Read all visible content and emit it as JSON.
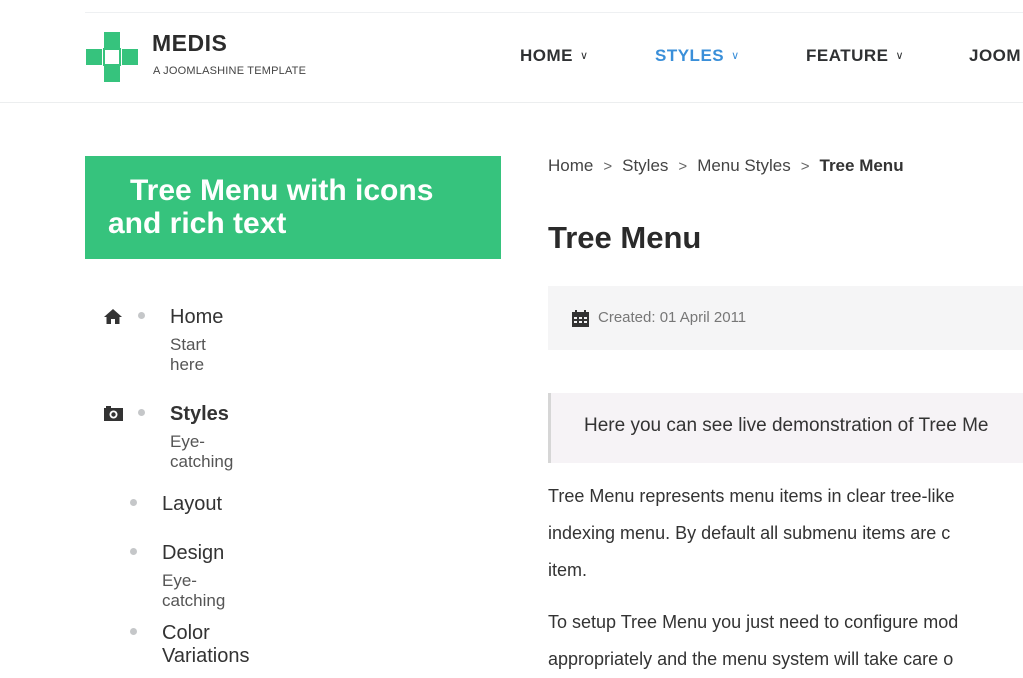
{
  "header": {
    "brand_name": "MEDIS",
    "brand_tagline": "A JOOMLASHINE TEMPLATE",
    "nav": [
      {
        "label": "HOME",
        "active": false
      },
      {
        "label": "STYLES",
        "active": true
      },
      {
        "label": "FEATURE",
        "active": false
      },
      {
        "label": "JOOM",
        "active": false
      }
    ],
    "accent_color": "#3a8fd9",
    "logo_color": "#36c37d"
  },
  "sidebar": {
    "title": "Tree Menu with icons and rich text",
    "title_bg": "#36c37d",
    "items": [
      {
        "label": "Home",
        "sub": "Start here",
        "icon": "home-icon"
      },
      {
        "label": "Styles",
        "sub": "Eye-catching",
        "icon": "camera-icon"
      },
      {
        "label": "Layout",
        "sub": ""
      },
      {
        "label": "Design",
        "sub": "Eye-catching"
      },
      {
        "label": "Color Variations",
        "sub": ""
      }
    ]
  },
  "main": {
    "breadcrumb": [
      "Home",
      "Styles",
      "Menu Styles",
      "Tree Menu"
    ],
    "title": "Tree Menu",
    "created": "Created: 01 April 2011",
    "intro": "Here you can see live demonstration of Tree Me",
    "para1": [
      "Tree Menu represents menu items in clear tree-like",
      "indexing menu. By default all submenu items are c",
      "item."
    ],
    "para2": [
      "To setup Tree Menu you just need to configure mod",
      "appropriately and the menu system will take care o"
    ]
  }
}
